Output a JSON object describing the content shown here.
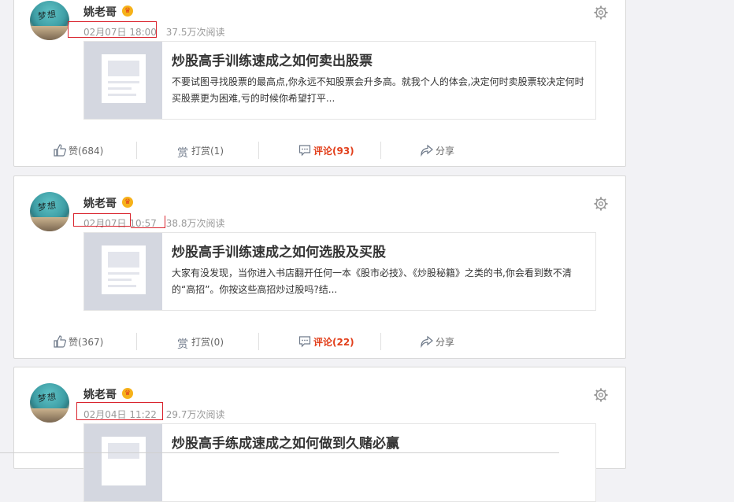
{
  "posts": [
    {
      "author": "姚老哥",
      "time": "02月07日 18:00",
      "reads": "37.5万次阅读",
      "article_title": "炒股高手训练速成之如何卖出股票",
      "article_excerpt": "不要试图寻找股票的最高点,你永远不知股票会升多高。就我个人的体会,决定何时卖股票较决定何时买股票更为困难,亏的时候你希望打平...",
      "like_label": "赞(684)",
      "tip_label": "打赏(1)",
      "comment_label": "评论(93)",
      "share_label": "分享"
    },
    {
      "author": "姚老哥",
      "time": "02月07日 10:57",
      "reads": "38.8万次阅读",
      "article_title": "炒股高手训练速成之如何选股及买股",
      "article_excerpt": "大家有没发现，当你进入书店翻开任何一本《股市必技》、《炒股秘籍》之类的书,你会看到数不清的“高招”。你按这些高招炒过股吗?结...",
      "like_label": "赞(367)",
      "tip_label": "打赏(0)",
      "comment_label": "评论(22)",
      "share_label": "分享"
    },
    {
      "author": "姚老哥",
      "time": "02月04日 11:22",
      "reads": "29.7万次阅读",
      "article_title": "炒股高手练成速成之如何做到久赌必赢"
    }
  ],
  "avatar_text": "梦想",
  "colors": {
    "accent": "#e2401c",
    "highlight_box": "#d9232d",
    "crown": "#f6b21a"
  },
  "icons": [
    "avatar",
    "crown-icon",
    "gear-icon",
    "like-icon",
    "tip-icon",
    "comment-icon",
    "share-icon"
  ]
}
